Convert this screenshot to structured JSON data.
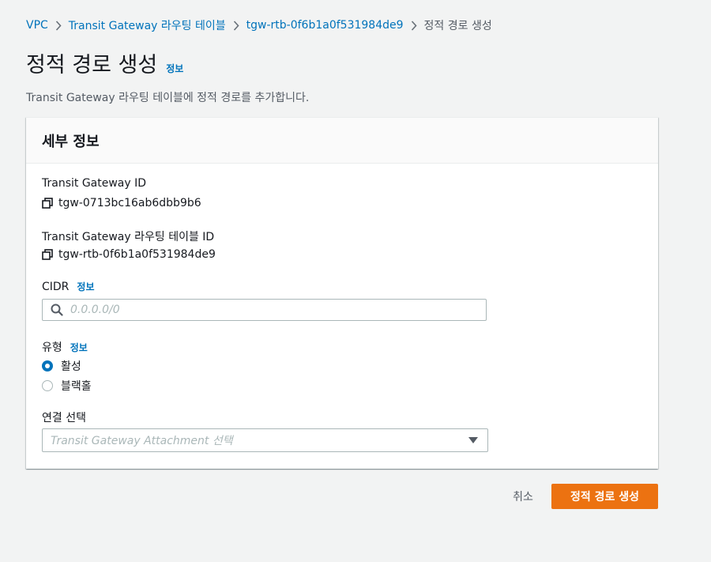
{
  "breadcrumb": {
    "items": [
      {
        "label": "VPC"
      },
      {
        "label": "Transit Gateway 라우팅 테이블"
      },
      {
        "label": "tgw-rtb-0f6b1a0f531984de9"
      }
    ],
    "current": "정적 경로 생성"
  },
  "page": {
    "title": "정적 경로 생성",
    "info_link": "정보",
    "description": "Transit Gateway 라우팅 테이블에 정적 경로를 추가합니다."
  },
  "details": {
    "header": "세부 정보",
    "tgw_id_label": "Transit Gateway ID",
    "tgw_id_value": "tgw-0713bc16ab6dbb9b6",
    "tgw_rtb_label": "Transit Gateway 라우팅 테이블 ID",
    "tgw_rtb_value": "tgw-rtb-0f6b1a0f531984de9",
    "cidr_label": "CIDR",
    "cidr_info": "정보",
    "cidr_value": "",
    "cidr_placeholder": "0.0.0.0/0",
    "type_label": "유형",
    "type_info": "정보",
    "type_options": [
      {
        "label": "활성",
        "selected": true
      },
      {
        "label": "블랙홀",
        "selected": false
      }
    ],
    "attachment_label": "연결 선택",
    "attachment_placeholder": "Transit Gateway Attachment 선택"
  },
  "actions": {
    "cancel_label": "취소",
    "submit_label": "정적 경로 생성"
  },
  "colors": {
    "link": "#0073bb",
    "primary": "#ec7211",
    "background": "#f2f3f3"
  },
  "icons": {
    "breadcrumb_separator": "chevron-right-icon",
    "copy": "copy-icon",
    "search": "search-icon",
    "dropdown": "caret-down-icon"
  }
}
